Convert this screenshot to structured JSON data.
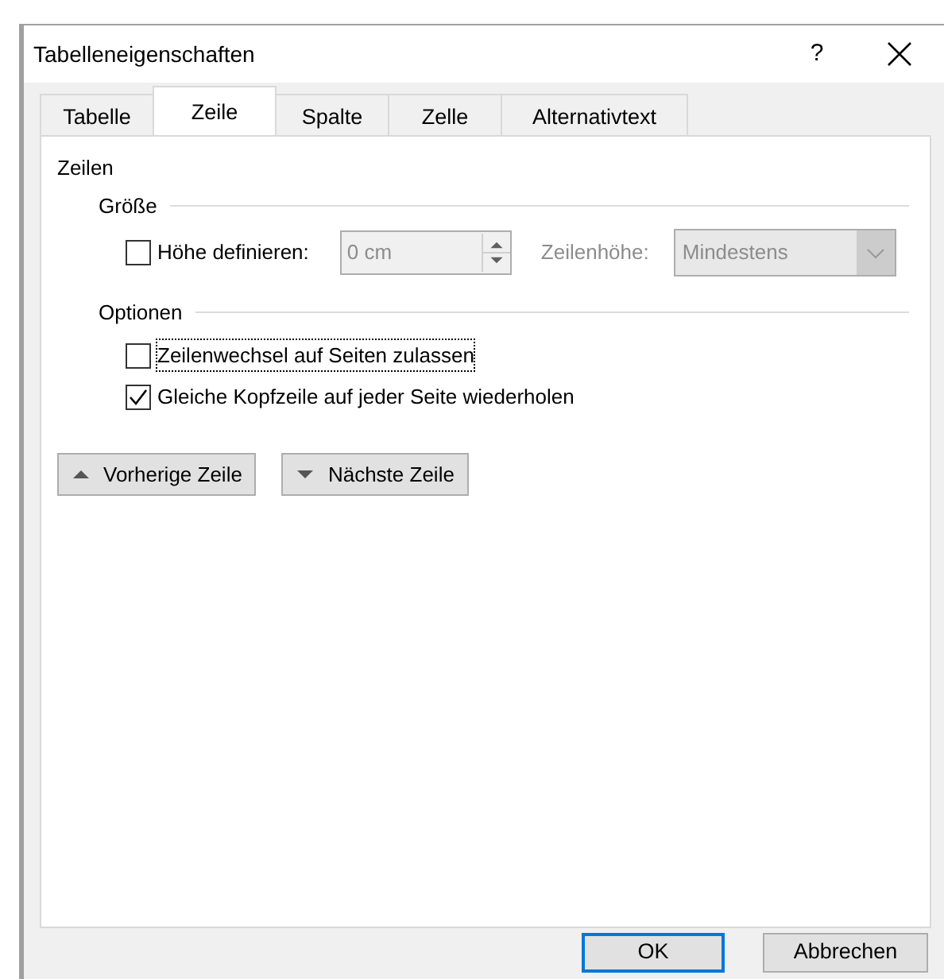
{
  "window": {
    "title": "Tabelleneigenschaften",
    "help": "?"
  },
  "tabs": [
    {
      "label": "Tabelle",
      "selected": false
    },
    {
      "label": "Zeile",
      "selected": true
    },
    {
      "label": "Spalte",
      "selected": false
    },
    {
      "label": "Zelle",
      "selected": false
    },
    {
      "label": "Alternativtext",
      "selected": false
    }
  ],
  "group_title": "Zeilen",
  "size": {
    "heading": "Größe",
    "height_checkbox": {
      "label": "Höhe definieren:",
      "checked": false
    },
    "height_field": {
      "value": "0 cm",
      "disabled": true
    },
    "row_height_label": "Zeilenhöhe:",
    "row_height_select": {
      "value": "Mindestens",
      "disabled": true
    }
  },
  "options": {
    "heading": "Optionen",
    "checkboxes": [
      {
        "label": "Zeilenwechsel auf Seiten zulassen",
        "checked": false,
        "focused": true
      },
      {
        "label": "Gleiche Kopfzeile auf jeder Seite wiederholen",
        "checked": true,
        "focused": false
      }
    ]
  },
  "nav_buttons": [
    {
      "label": "Vorherige Zeile",
      "kind": "up"
    },
    {
      "label": "Nächste Zeile",
      "kind": "down"
    }
  ],
  "buttons": [
    {
      "label": "OK",
      "default": true
    },
    {
      "label": "Abbrechen",
      "default": false
    }
  ]
}
